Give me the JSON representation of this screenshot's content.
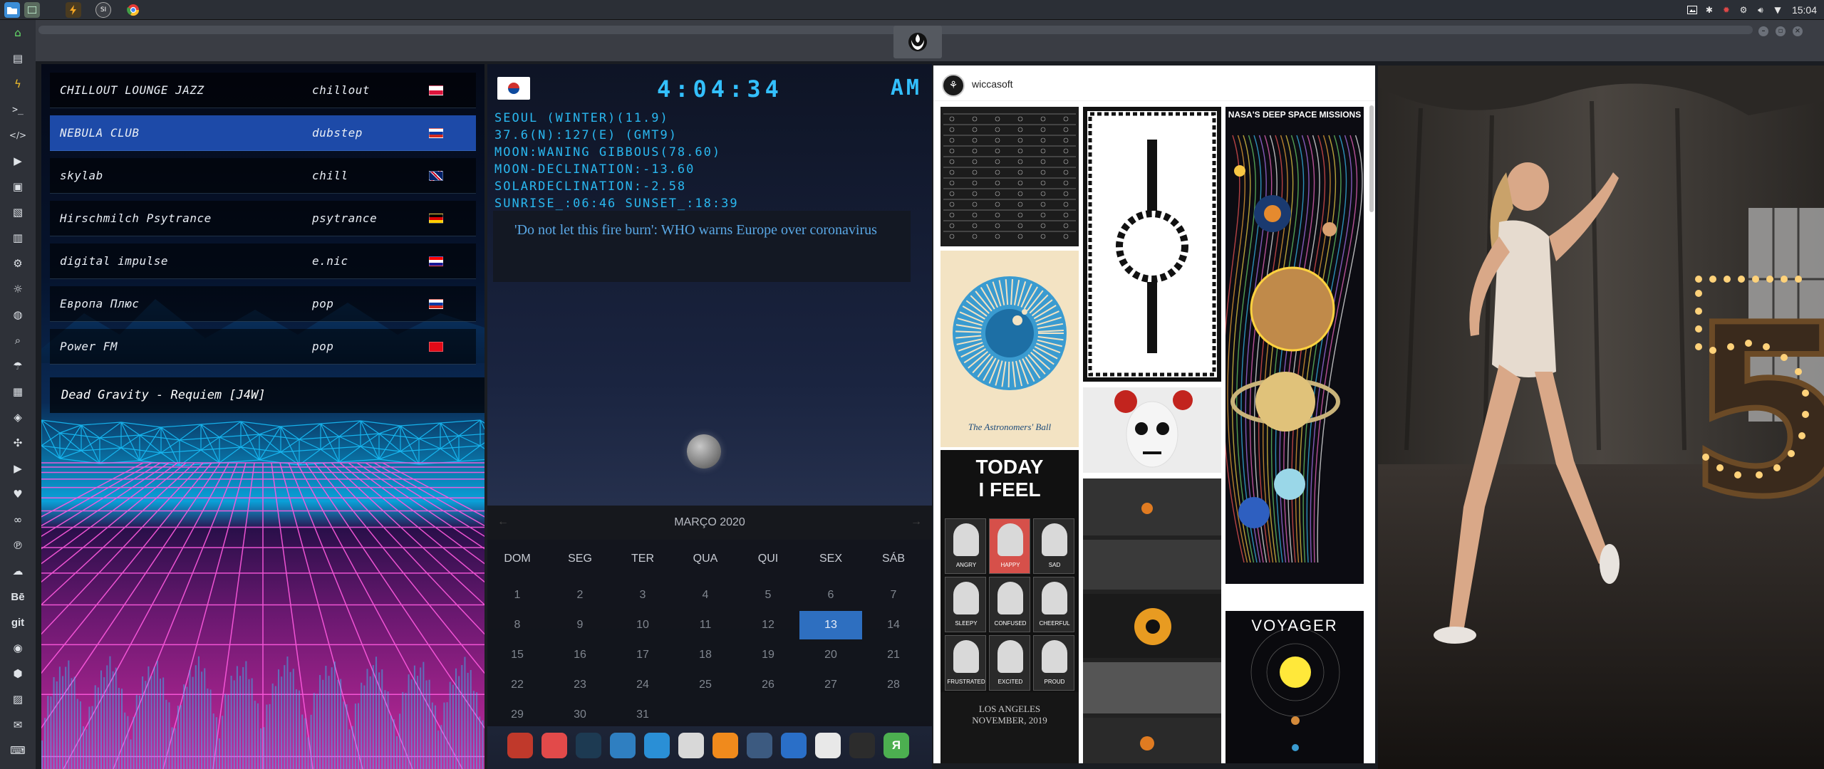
{
  "topbar": {
    "apps": [
      {
        "icon": "folder-icon",
        "color": "#3b8ed8"
      },
      {
        "icon": "window-icon",
        "color": "#5a6b5e"
      },
      {
        "icon": "bolt-app-icon",
        "color": "#f5a623"
      },
      {
        "icon": "si-icon",
        "label": "SI",
        "color": "#4a4a4a"
      },
      {
        "icon": "chrome-icon",
        "color": "#4285f4"
      }
    ],
    "clock": "15:04"
  },
  "window": {
    "tab_icon": "rebel-alliance-icon"
  },
  "radio": {
    "stations": [
      {
        "name": "CHILLOUT LOUNGE JAZZ",
        "genre": "chillout",
        "flag": "poland"
      },
      {
        "name": "NEBULA CLUB",
        "genre": "dubstep",
        "flag": "russia",
        "selected": true
      },
      {
        "name": "skylab",
        "genre": "chill",
        "flag": "uk"
      },
      {
        "name": "Hirschmilch Psytrance",
        "genre": "psytrance",
        "flag": "germany"
      },
      {
        "name": "digital impulse",
        "genre": "e.nic",
        "flag": "croatia"
      },
      {
        "name": "Европа Плюс",
        "genre": "pop",
        "flag": "russia"
      },
      {
        "name": "Power FM",
        "genre": "pop",
        "flag": "turkey"
      }
    ],
    "now_playing": "Dead Gravity - Requiem [J4W]"
  },
  "clockwidget": {
    "time": "4:04:34",
    "ampm": "AM",
    "lines": [
      "SEOUL (WINTER)(11.9)",
      "37.6(N):127(E) (GMT9)",
      "MOON:WANING GIBBOUS(78.60)",
      "MOON-DECLINATION:-13.60",
      "SOLARDECLINATION:-2.58",
      "SUNRISE_:06:46 SUNSET_:18:39"
    ],
    "news": "'Do not let this fire burn': WHO warns Europe over coronavirus"
  },
  "calendar": {
    "month": "MARÇO 2020",
    "days_of_week": [
      "DOM",
      "SEG",
      "TER",
      "QUA",
      "QUI",
      "SEX",
      "SÁB"
    ],
    "weeks": [
      [
        "1",
        "2",
        "3",
        "4",
        "5",
        "6",
        "7"
      ],
      [
        "8",
        "9",
        "10",
        "11",
        "12",
        "13",
        "14"
      ],
      [
        "15",
        "16",
        "17",
        "18",
        "19",
        "20",
        "21"
      ],
      [
        "22",
        "23",
        "24",
        "25",
        "26",
        "27",
        "28"
      ],
      [
        "29",
        "30",
        "31",
        "",
        "",
        "",
        ""
      ]
    ],
    "today": "13"
  },
  "dock": [
    {
      "icon": "triangle-app-icon",
      "color": "#c0392b",
      "label": ""
    },
    {
      "icon": "hourglass-icon",
      "color": "#e24a4a",
      "label": ""
    },
    {
      "icon": "globe-dark-icon",
      "color": "#1d3a52",
      "label": ""
    },
    {
      "icon": "image-viewer-icon",
      "color": "#2f7fc1",
      "label": ""
    },
    {
      "icon": "translate-icon",
      "color": "#2a8fd6",
      "label": ""
    },
    {
      "icon": "news-icon",
      "color": "#d8d8d8",
      "label": ""
    },
    {
      "icon": "search-app-icon",
      "color": "#f08a1c",
      "label": ""
    },
    {
      "icon": "clock-app-icon",
      "color": "#3c5a80",
      "label": ""
    },
    {
      "icon": "globe-icon",
      "color": "#2a6fc8",
      "label": ""
    },
    {
      "icon": "calendar-app-icon",
      "color": "#e8e8e8",
      "label": ""
    },
    {
      "icon": "arrow-app-icon",
      "color": "#2c2c2c",
      "label": ""
    },
    {
      "icon": "yandex-icon",
      "color": "#4caf50",
      "label": "Я"
    }
  ],
  "pinterest": {
    "user": "wiccasoft",
    "pins": [
      {
        "caption_lines": [
          "The Astronomers' Ball"
        ]
      },
      {
        "caption_lines": [
          "TODAY",
          "I FEEL"
        ],
        "moods": [
          "ANGRY",
          "HAPPY",
          "SAD",
          "SLEEPY",
          "CONFUSED",
          "CHEERFUL",
          "FRUSTRATED",
          "EXCITED",
          "PROUD"
        ]
      },
      {
        "caption_lines": [
          "LOS ANGELES",
          "NOVEMBER, 2019"
        ]
      },
      {
        "caption_lines": [
          "NASA'S DEEP SPACE MISSIONS"
        ]
      },
      {
        "caption_lines": [
          "VOYAGER"
        ]
      }
    ]
  },
  "photo": {
    "number": "5"
  }
}
